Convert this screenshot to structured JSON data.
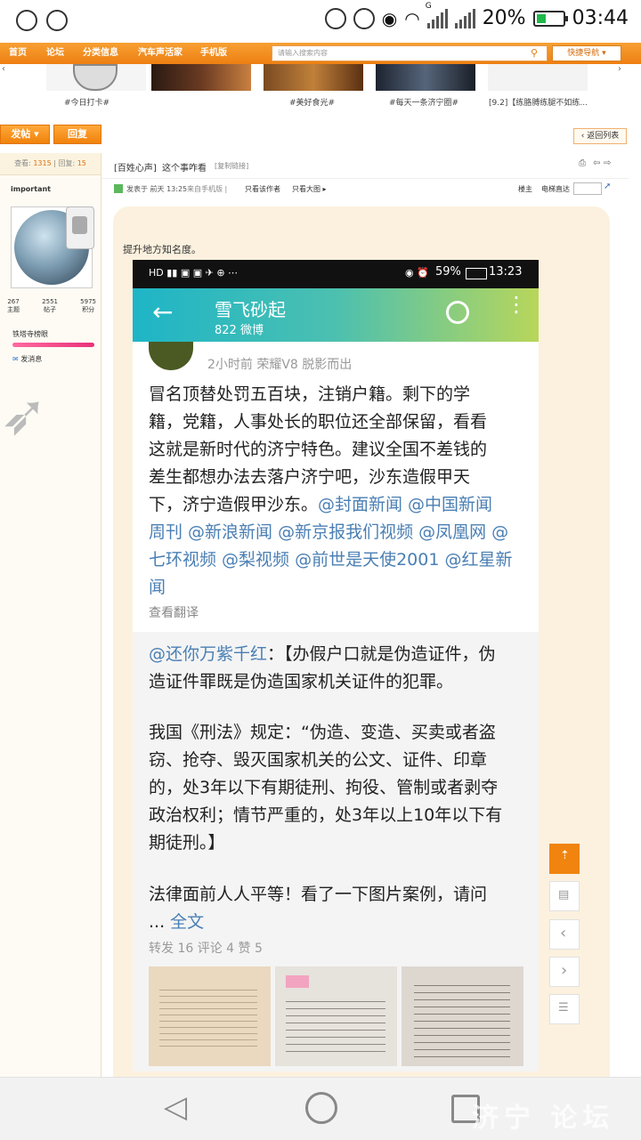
{
  "status_bar": {
    "battery": "20%",
    "time": "03:44",
    "signal_label": "G"
  },
  "nav": {
    "items": [
      "首页",
      "论坛",
      "分类信息",
      "汽车声活家",
      "手机版"
    ],
    "search_placeholder": "请输入搜索内容",
    "quick_nav": "快捷导航"
  },
  "thumbnails": [
    {
      "caption": "#今日打卡#"
    },
    {
      "caption": ""
    },
    {
      "caption": "#美好食光#"
    },
    {
      "caption": "#每天一条济宁圈#"
    },
    {
      "caption": "[9.2]【练胳膊练腿不如练..."
    }
  ],
  "actions": {
    "post": "发帖",
    "reply": "回复",
    "back_list": "返回列表"
  },
  "thread": {
    "stats_view_label": "查看:",
    "views": "1315",
    "stats_reply_label": "回复:",
    "replies": "15",
    "category": "[百姓心声]",
    "title": "这个事咋看",
    "copy_link": "[复制链接]"
  },
  "author": {
    "name": "important",
    "topics": "267",
    "posts": "2551",
    "points": "5975",
    "topics_label": "主题",
    "posts_label": "帖子",
    "points_label": "积分",
    "rank": "铁塔寺榜眼",
    "message": "发消息"
  },
  "meta": {
    "posted": "发表于 前天 13:25",
    "device": "来自手机版 |",
    "only_author": "只看该作者",
    "big_image": "只看大图",
    "floor": "楼主",
    "jump": "电梯直达"
  },
  "post": {
    "intro": "提升地方知名度。"
  },
  "weibo": {
    "status": {
      "battery": "59%",
      "time": "13:23"
    },
    "header": {
      "title": "雪飞砂起",
      "subtitle": "822 微博"
    },
    "post_meta": "2小时前    荣耀V8 脱影而出",
    "body_lines": [
      "冒名顶替处罚五百块，注销户籍。剩下的学",
      "籍，党籍，人事处长的职位还全部保留，看看",
      "这就是新时代的济宁特色。建议全国不差钱的",
      "差生都想办法去落户济宁吧，沙东造假甲天",
      "下，济宁造假甲沙东。"
    ],
    "mention_inline": "@封面新闻 @中国新闻",
    "mention_lines": [
      "周刊 @新浪新闻 @新京报我们视频 @凤凰网 @",
      "七环视频 @梨视频 @前世是天使2001 @红星新",
      "闻"
    ],
    "translate": "查看翻译",
    "repost": {
      "user": "@还你万紫千红",
      "line1": "：【办假户口就是伪造证件，伪",
      "line2": "造证件罪既是伪造国家机关证件的犯罪。",
      "law_lines": [
        "我国《刑法》规定：“伪造、变造、买卖或者盗",
        "窃、抢夺、毁灭国家机关的公文、证件、印章",
        "的，处3年以下有期徒刑、拘役、管制或者剥夺",
        "政治权利；情节严重的，处3年以上10年以下有",
        "期徒刑。】"
      ],
      "conclusion": "法律面前人人平等！看了一下图片案例，请问",
      "ellipsis": "...",
      "full_text": "全文",
      "stats": "转发 16    评论 4    赞 5"
    }
  },
  "watermark": "济宁 论坛"
}
